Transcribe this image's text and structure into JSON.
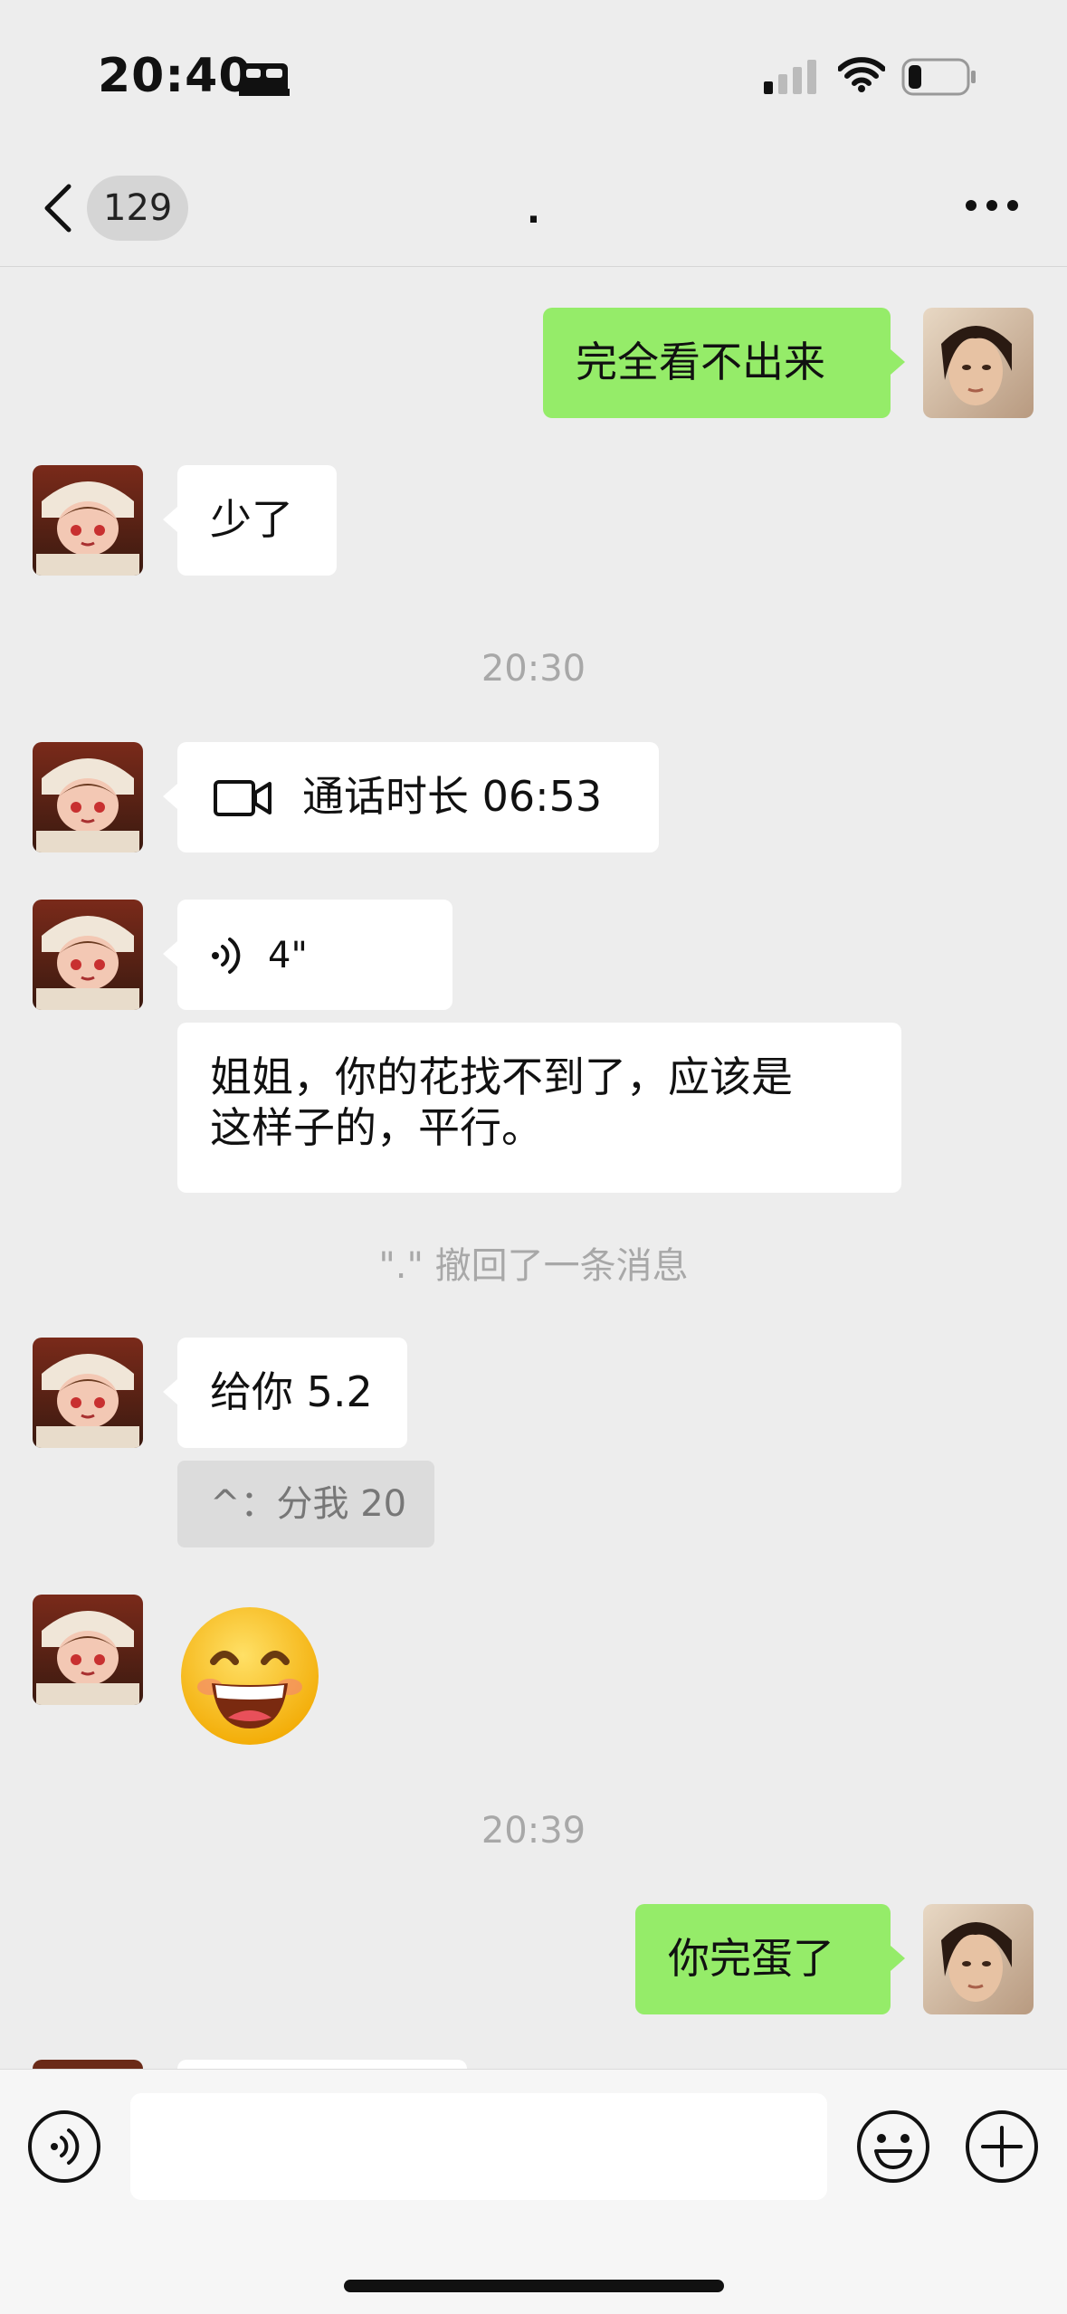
{
  "status_bar": {
    "time": "20:40"
  },
  "nav": {
    "unread_count": "129",
    "title": "."
  },
  "messages": {
    "m1": {
      "text": "完全看不出来"
    },
    "m2": {
      "text": "少了"
    },
    "ts1": "20:30",
    "m3": {
      "label": "通话时长 06:53",
      "icon": "video-call-icon"
    },
    "m4": {
      "duration": "4\"",
      "icon": "voice-icon"
    },
    "m5": {
      "line1": "姐姐，你的花找不到了，应该是",
      "line2": "这样子的，平行。"
    },
    "sys1": "\".\" 撤回了一条消息",
    "m6": {
      "text": "给你 5.2",
      "quote": "^：分我 20"
    },
    "m7": {
      "emoji": "grinning-emoji"
    },
    "ts2": "20:39",
    "m8": {
      "text": "你完蛋了"
    }
  },
  "input_bar": {
    "placeholder": "",
    "value": ""
  },
  "colors": {
    "background": "#ededed",
    "outgoing_bubble": "#95ec69",
    "incoming_bubble": "#ffffff",
    "input_bar": "#f6f6f6"
  }
}
